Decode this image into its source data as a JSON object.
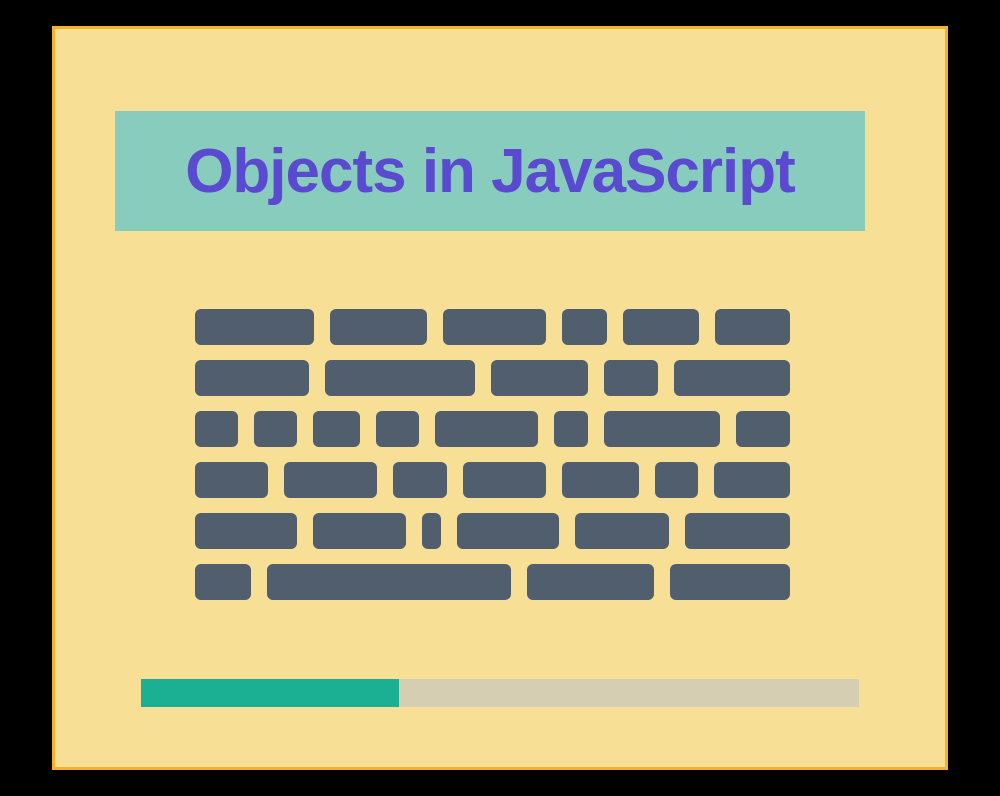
{
  "title": "Objects in JavaScript",
  "colors": {
    "background_outer": "#000000",
    "card_bg": "#f8df96",
    "card_border": "#f3b229",
    "title_bg": "#88ccbd",
    "title_text": "#5a4ad0",
    "word_fill": "#505e6d",
    "progress_track": "#d6ceb3",
    "progress_fill": "#1bb094"
  },
  "text_lines": [
    [
      130,
      105,
      112,
      50,
      82,
      82
    ],
    [
      118,
      155,
      100,
      56,
      120
    ],
    [
      48,
      48,
      52,
      48,
      115,
      38,
      130,
      60
    ],
    [
      78,
      100,
      58,
      90,
      82,
      46,
      82
    ],
    [
      108,
      100,
      20,
      108,
      100,
      112
    ],
    [
      58,
      252,
      132,
      124
    ]
  ],
  "progress_percent": 36
}
